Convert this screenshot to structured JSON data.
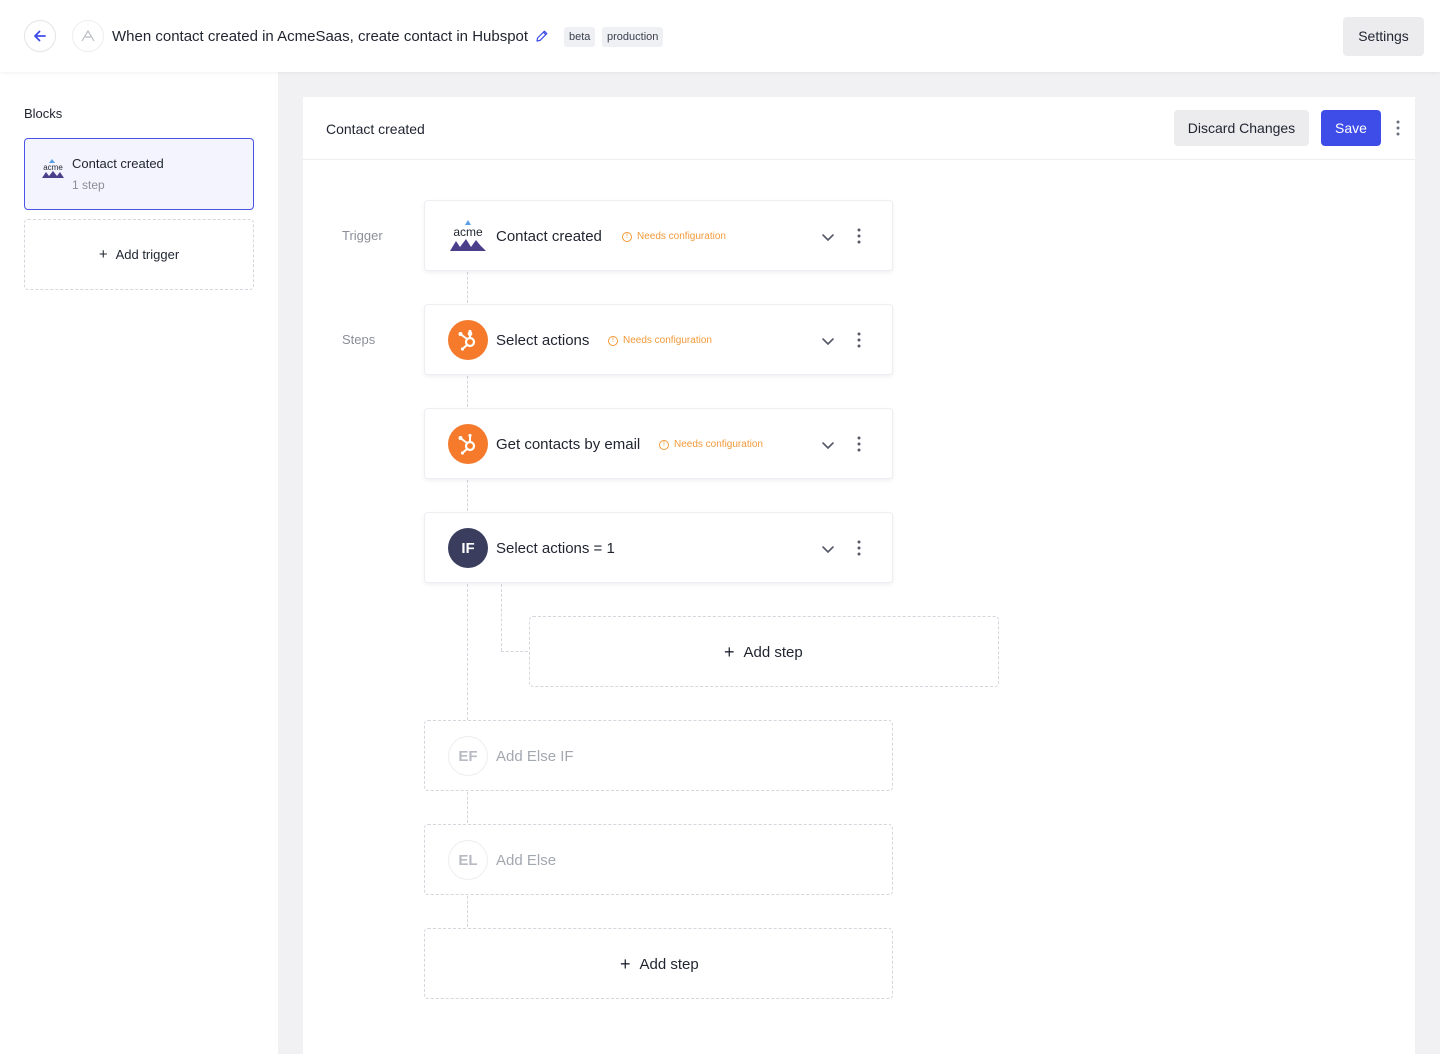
{
  "header": {
    "title": "When contact created in AcmeSaas, create contact in Hubspot",
    "tags": [
      "beta",
      "production"
    ],
    "settings_label": "Settings"
  },
  "sidebar": {
    "heading": "Blocks",
    "block": {
      "title": "Contact created",
      "subtitle": "1 step",
      "logo_text": "acme"
    },
    "add_trigger_label": "Add trigger"
  },
  "main": {
    "title": "Contact created",
    "discard_label": "Discard Changes",
    "save_label": "Save",
    "trigger_label": "Trigger",
    "steps_label": "Steps"
  },
  "flow": {
    "trigger": {
      "name": "Contact created",
      "warning": "Needs configuration",
      "icon": "acme-logo",
      "logo_text": "acme"
    },
    "steps": [
      {
        "name": "Select actions",
        "warning": "Needs configuration",
        "icon": "hubspot-icon"
      },
      {
        "name": "Get contacts by email",
        "warning": "Needs configuration",
        "icon": "hubspot-icon"
      }
    ],
    "condition": {
      "badge": "IF",
      "name": "Select actions = 1"
    },
    "branch_add_step": "Add step",
    "else_if": {
      "badge": "EF",
      "label": "Add Else IF"
    },
    "else": {
      "badge": "EL",
      "label": "Add Else"
    },
    "add_step": "Add step"
  },
  "colors": {
    "accent": "#3e4ce8",
    "hubspot": "#f57a2c",
    "warning": "#f29a3a",
    "if_badge": "#3b3d5e",
    "acme_purple": "#4b3f8c"
  }
}
